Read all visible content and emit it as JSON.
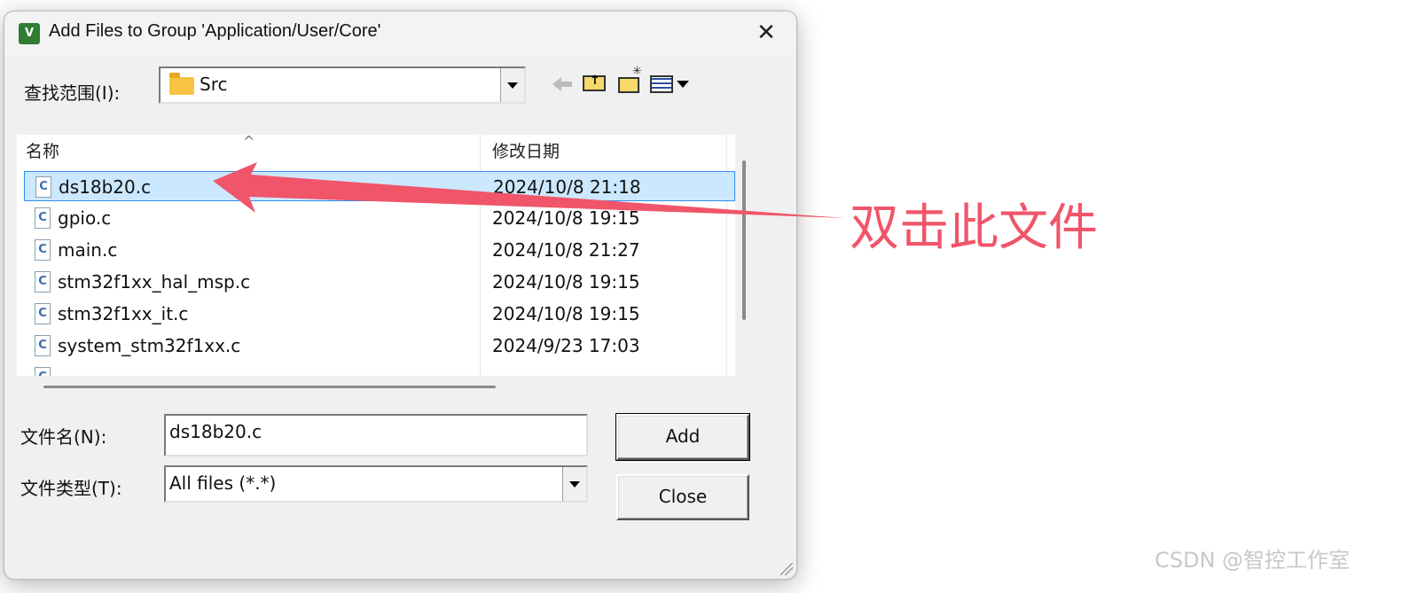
{
  "dialog": {
    "title": "Add Files to Group 'Application/User/Core'",
    "app_icon": "keil-uvision-icon",
    "close_glyph": "✕"
  },
  "look_in": {
    "label": "查找范围(I):",
    "value": "Src"
  },
  "toolbar": {
    "icons": [
      "back-arrow-icon",
      "up-folder-icon",
      "new-folder-icon",
      "view-menu-icon"
    ]
  },
  "file_list": {
    "columns": [
      "名称",
      "修改日期"
    ],
    "rows": [
      {
        "name": "ds18b20.c",
        "date": "2024/10/8 21:18",
        "selected": true
      },
      {
        "name": "gpio.c",
        "date": "2024/10/8 19:15"
      },
      {
        "name": "main.c",
        "date": "2024/10/8 21:27"
      },
      {
        "name": "stm32f1xx_hal_msp.c",
        "date": "2024/10/8 19:15"
      },
      {
        "name": "stm32f1xx_it.c",
        "date": "2024/10/8 19:15"
      },
      {
        "name": "system_stm32f1xx.c",
        "date": "2024/9/23 17:03"
      }
    ]
  },
  "filename": {
    "label": "文件名(N):",
    "value": "ds18b20.c"
  },
  "filetype": {
    "label": "文件类型(T):",
    "value": "All files (*.*)"
  },
  "buttons": {
    "add": "Add",
    "close": "Close"
  },
  "annotation": {
    "text": "双击此文件",
    "color": "#f0556a"
  },
  "watermark": "CSDN @智控工作室"
}
